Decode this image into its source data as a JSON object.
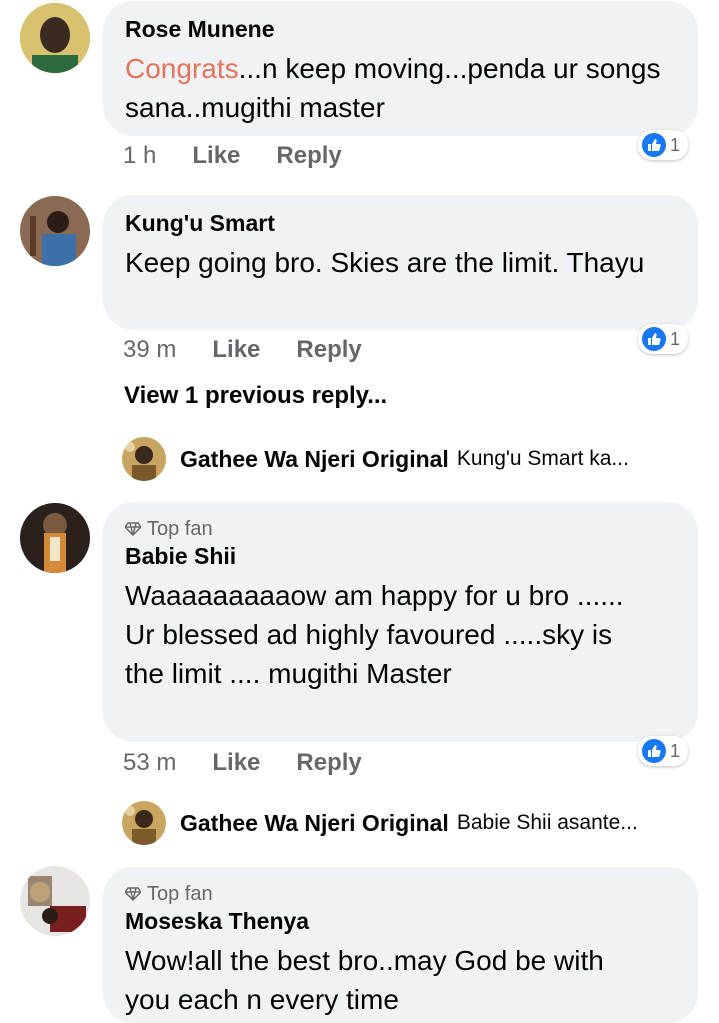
{
  "comments": [
    {
      "name": "Rose Munene",
      "text_highlight": "Congrats",
      "text_rest": "...n keep moving...penda ur songs sana..mugithi master",
      "time": "1 h",
      "like_label": "Like",
      "reply_label": "Reply",
      "reactions": "1"
    },
    {
      "name": "Kung'u Smart",
      "text": "Keep going bro. Skies are the limit. Thayu",
      "time": "39 m",
      "like_label": "Like",
      "reply_label": "Reply",
      "reactions": "1",
      "view_previous": "View 1 previous reply...",
      "reply": {
        "name": "Gathee Wa Njeri Original",
        "text": "Kung'u Smart ka..."
      }
    },
    {
      "badge": "Top fan",
      "name": "Babie Shii",
      "text": "Waaaaaaaaaow am  happy for u bro ...... Ur blessed ad highly favoured .....sky is the limit .... mugithi Master",
      "time": "53 m",
      "like_label": "Like",
      "reply_label": "Reply",
      "reactions": "1",
      "reply": {
        "name": "Gathee Wa Njeri Original",
        "text": "Babie Shii asante..."
      }
    },
    {
      "badge": "Top fan",
      "name": "Moseska Thenya",
      "text": "Wow!all the best bro..may God be with you each n every time"
    }
  ],
  "colors": {
    "like_blue": "#1877f2",
    "bubble": "#f0f2f5",
    "meta_gray": "#65676b",
    "highlight": "#e9725a"
  }
}
